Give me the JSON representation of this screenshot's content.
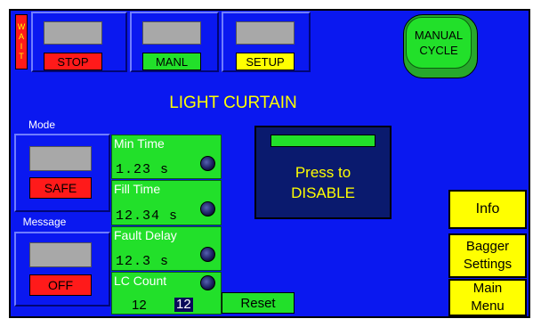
{
  "wait": {
    "letters": [
      "W",
      "A",
      "I",
      "T"
    ]
  },
  "toolbar": {
    "stop_label": "STOP",
    "manl_label": "MANL",
    "setup_label": "SETUP"
  },
  "manual_cycle": {
    "line1": "MANUAL",
    "line2": "CYCLE"
  },
  "page_title": "LIGHT CURTAIN",
  "mode": {
    "label": "Mode",
    "button": "SAFE"
  },
  "message": {
    "label": "Message",
    "button": "OFF"
  },
  "min_time": {
    "label": "Min Time",
    "value": "1.23 s"
  },
  "fill_time": {
    "label": "Fill Time",
    "value": "12.34 s"
  },
  "fault_delay": {
    "label": "Fault Delay",
    "value": "12.3 s"
  },
  "lc_count": {
    "label": "LC Count",
    "value": "12",
    "value_highlight": "12"
  },
  "reset_label": "Reset",
  "disable_panel": {
    "line1": "Press to",
    "line2": "DISABLE"
  },
  "side": {
    "info": "Info",
    "bagger_line1": "Bagger",
    "bagger_line2": "Settings",
    "main_line1": "Main",
    "main_line2": "Menu"
  },
  "colors": {
    "background": "#0a18f0",
    "green": "#22e02a",
    "red": "#ff1a1a",
    "yellow": "#ffff00"
  }
}
